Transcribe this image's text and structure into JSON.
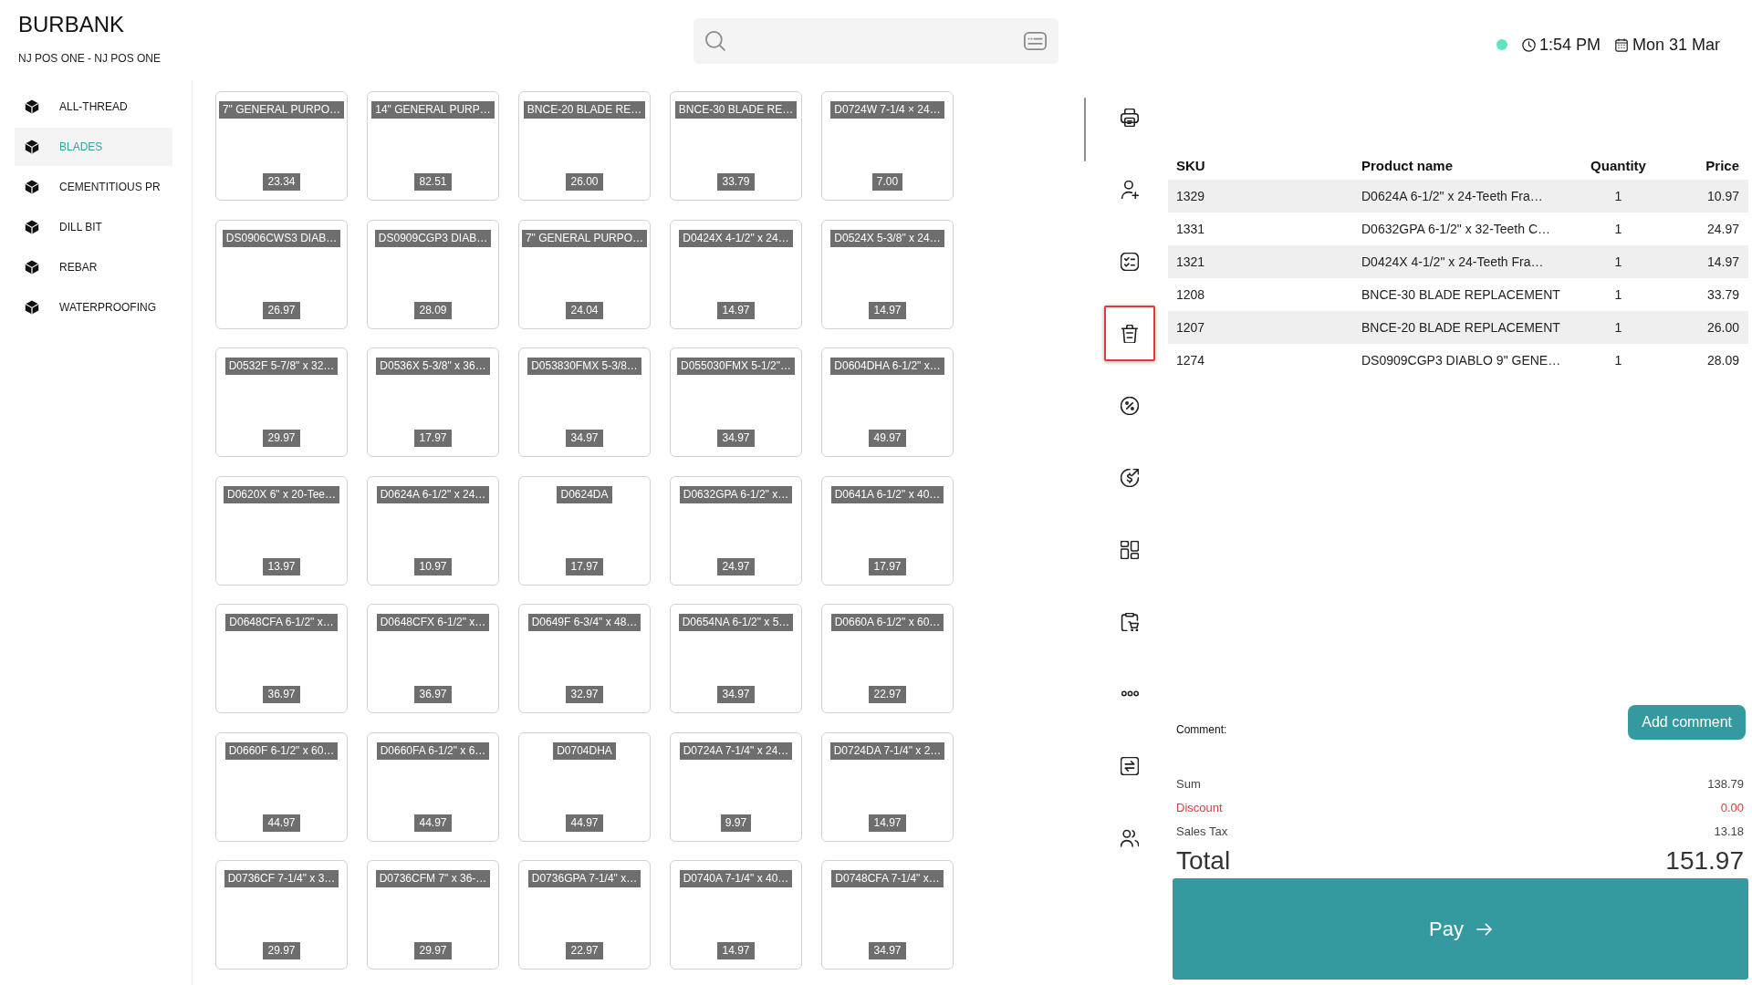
{
  "store": {
    "name": "BURBANK",
    "register": "NJ POS ONE - NJ POS ONE"
  },
  "status": {
    "online": true,
    "time": "1:54 PM",
    "date": "Mon 31 Mar"
  },
  "categories": [
    {
      "label": "ALL-THREAD",
      "selected": false
    },
    {
      "label": "BLADES",
      "selected": true
    },
    {
      "label": "CEMENTITIOUS PR",
      "selected": false
    },
    {
      "label": "DILL BIT",
      "selected": false
    },
    {
      "label": "REBAR",
      "selected": false
    },
    {
      "label": "WATERPROOFING",
      "selected": false
    }
  ],
  "products": [
    {
      "name": "7\" GENERAL PURPO…",
      "price": "23.34"
    },
    {
      "name": "14\" GENERAL PURP…",
      "price": "82.51"
    },
    {
      "name": "BNCE-20 BLADE RE…",
      "price": "26.00"
    },
    {
      "name": "BNCE-30 BLADE RE…",
      "price": "33.79"
    },
    {
      "name": "D0724W 7-1/4 × 24…",
      "price": "7.00"
    },
    {
      "name": "DS0906CWS3 DIAB…",
      "price": "26.97"
    },
    {
      "name": "DS0909CGP3 DIAB…",
      "price": "28.09"
    },
    {
      "name": "7\" GENERAL PURPO…",
      "price": "24.04"
    },
    {
      "name": "D0424X 4-1/2\" x 24…",
      "price": "14.97"
    },
    {
      "name": "D0524X 5-3/8\" x 24…",
      "price": "14.97"
    },
    {
      "name": "D0532F 5-7/8\" x 32…",
      "price": "29.97"
    },
    {
      "name": "D0536X 5-3/8\" x 36…",
      "price": "17.97"
    },
    {
      "name": "D053830FMX 5-3/8…",
      "price": "34.97"
    },
    {
      "name": "D055030FMX 5-1/2\"…",
      "price": "34.97"
    },
    {
      "name": "D0604DHA 6-1/2\" x…",
      "price": "49.97"
    },
    {
      "name": "D0620X 6\" x 20-Tee…",
      "price": "13.97"
    },
    {
      "name": "D0624A 6-1/2\" x 24…",
      "price": "10.97"
    },
    {
      "name": "D0624DA",
      "price": "17.97"
    },
    {
      "name": "D0632GPA 6-1/2\" x…",
      "price": "24.97"
    },
    {
      "name": "D0641A 6-1/2\" x 40…",
      "price": "17.97"
    },
    {
      "name": "D0648CFA 6-1/2\" x…",
      "price": "36.97"
    },
    {
      "name": "D0648CFX 6-1/2\" x…",
      "price": "36.97"
    },
    {
      "name": "D0649F 6-3/4\" x 48…",
      "price": "32.97"
    },
    {
      "name": "D0654NA 6-1/2\" x 5…",
      "price": "34.97"
    },
    {
      "name": "D0660A 6-1/2\" x 60…",
      "price": "22.97"
    },
    {
      "name": "D0660F 6-1/2\" x 60…",
      "price": "44.97"
    },
    {
      "name": "D0660FA 6-1/2\" x 6…",
      "price": "44.97"
    },
    {
      "name": "D0704DHA",
      "price": "44.97"
    },
    {
      "name": "D0724A 7-1/4\" x 24…",
      "price": "9.97"
    },
    {
      "name": "D0724DA 7-1/4\" x 2…",
      "price": "14.97"
    },
    {
      "name": "D0736CF 7-1/4\" x 3…",
      "price": "29.97"
    },
    {
      "name": "D0736CFM 7\" x 36-…",
      "price": "29.97"
    },
    {
      "name": "D0736GPA 7-1/4\" x…",
      "price": "22.97"
    },
    {
      "name": "D0740A 7-1/4\" x 40…",
      "price": "14.97"
    },
    {
      "name": "D0748CFA 7-1/4\" x…",
      "price": "34.97"
    }
  ],
  "toolbar": [
    {
      "highlighted": false
    },
    {
      "highlighted": false
    },
    {
      "highlighted": false
    },
    {
      "highlighted": true
    },
    {
      "highlighted": false
    },
    {
      "highlighted": false
    },
    {
      "highlighted": false
    },
    {
      "highlighted": false
    },
    {
      "highlighted": false
    },
    {
      "highlighted": false
    },
    {
      "highlighted": false
    }
  ],
  "cart": {
    "columns": [
      "SKU",
      "Product name",
      "Quantity",
      "Price"
    ],
    "rows": [
      {
        "sku": "1329",
        "product_name": "D0624A 6-1/2\" x 24-Teeth Fra…",
        "quantity": "1",
        "price": "10.97"
      },
      {
        "sku": "1331",
        "product_name": "D0632GPA 6-1/2\" x 32-Teeth C…",
        "quantity": "1",
        "price": "24.97"
      },
      {
        "sku": "1321",
        "product_name": "D0424X 4-1/2\" x 24-Teeth Fra…",
        "quantity": "1",
        "price": "14.97"
      },
      {
        "sku": "1208",
        "product_name": "BNCE-30 BLADE REPLACEMENT",
        "quantity": "1",
        "price": "33.79"
      },
      {
        "sku": "1207",
        "product_name": "BNCE-20 BLADE REPLACEMENT",
        "quantity": "1",
        "price": "26.00"
      },
      {
        "sku": "1274",
        "product_name": "DS0909CGP3 DIABLO 9\" GENE…",
        "quantity": "1",
        "price": "28.09"
      }
    ]
  },
  "comment": {
    "label": "Comment:",
    "button": "Add comment"
  },
  "summary": [
    {
      "kind": "plain",
      "label": "Sum",
      "value": "138.79"
    },
    {
      "kind": "discount",
      "label": "Discount",
      "value": "0.00"
    },
    {
      "kind": "plain",
      "label": "Sales Tax",
      "value": "13.18"
    }
  ],
  "total": {
    "label": "Total",
    "value": "151.97"
  },
  "pay_button": {
    "label": "Pay"
  }
}
